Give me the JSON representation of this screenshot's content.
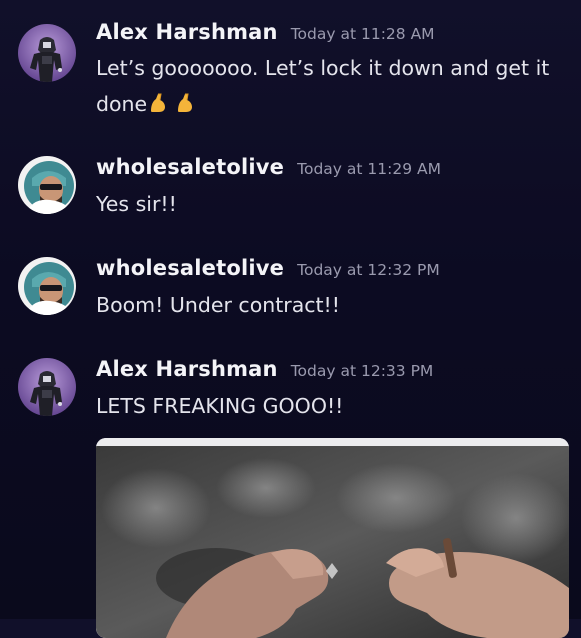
{
  "messages": [
    {
      "author": "Alex Harshman",
      "timestamp": "Today at 11:28 AM",
      "text": "Let’s gooooooo. Let’s lock it down and get it done",
      "emoji": "flexed-biceps x2"
    },
    {
      "author": "wholesaletolive",
      "timestamp": "Today at 11:29 AM",
      "text": "Yes sir!!"
    },
    {
      "author": "wholesaletolive",
      "timestamp": "Today at 12:32 PM",
      "text": "Boom! Under contract!!"
    },
    {
      "author": "Alex Harshman",
      "timestamp": "Today at 12:33 PM",
      "text": "LETS FREAKING GOOO!!"
    }
  ],
  "colors": {
    "background": "#0e0d24",
    "username": "#f4f4f8",
    "timestamp": "#9a9aae",
    "message_text": "#e4e4ec",
    "avatar_alex_bg": "#7a5aa8",
    "avatar_wholesale_bg": "#f2f2f2"
  },
  "icons": {
    "avatar_alex": "armored-figure-avatar",
    "avatar_wholesale": "bearded-man-sunglasses-avatar",
    "emoji": "flexed-biceps-emoji",
    "attachment": "fist-bump-gif"
  }
}
